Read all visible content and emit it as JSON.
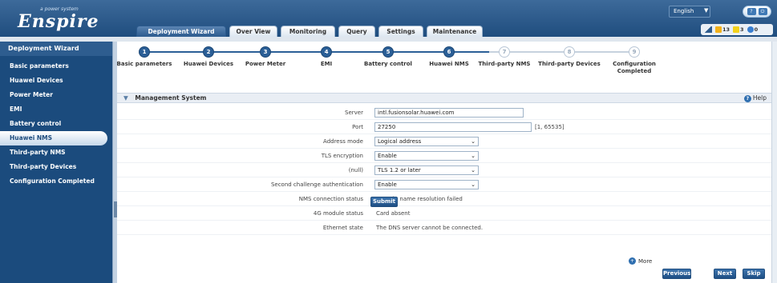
{
  "header": {
    "logo_text": "Enspire",
    "logo_tagline": "a power system",
    "language": "English",
    "alarms": [
      {
        "icon": "major-alarm-icon",
        "count": "13",
        "color": "#f3b21b"
      },
      {
        "icon": "minor-alarm-icon",
        "count": "3",
        "color": "#f3d21b"
      },
      {
        "icon": "info-alarm-icon",
        "count": "0",
        "color": "#3a7fd0"
      }
    ]
  },
  "tabs": [
    {
      "label": "Deployment Wizard",
      "active": true
    },
    {
      "label": "Over View",
      "active": false
    },
    {
      "label": "Monitoring",
      "active": false
    },
    {
      "label": "Query",
      "active": false
    },
    {
      "label": "Settings",
      "active": false
    },
    {
      "label": "Maintenance",
      "active": false
    }
  ],
  "sidebar": {
    "title": "Deployment Wizard",
    "items": [
      {
        "label": "Basic parameters",
        "active": false
      },
      {
        "label": "Huawei Devices",
        "active": false
      },
      {
        "label": "Power Meter",
        "active": false
      },
      {
        "label": "EMI",
        "active": false
      },
      {
        "label": "Battery control",
        "active": false
      },
      {
        "label": "Huawei NMS",
        "active": true
      },
      {
        "label": "Third-party NMS",
        "active": false
      },
      {
        "label": "Third-party Devices",
        "active": false
      },
      {
        "label": "Configuration Completed",
        "active": false
      }
    ]
  },
  "steps": [
    {
      "num": "1",
      "label": "Basic parameters",
      "done": true
    },
    {
      "num": "2",
      "label": "Huawei Devices",
      "done": true
    },
    {
      "num": "3",
      "label": "Power Meter",
      "done": true
    },
    {
      "num": "4",
      "label": "EMI",
      "done": true
    },
    {
      "num": "5",
      "label": "Battery control",
      "done": true
    },
    {
      "num": "6",
      "label": "Huawei NMS",
      "done": true
    },
    {
      "num": "7",
      "label": "Third-party NMS",
      "done": false
    },
    {
      "num": "8",
      "label": "Third-party Devices",
      "done": false
    },
    {
      "num": "9",
      "label": "Configuration Completed",
      "done": false
    }
  ],
  "panel": {
    "title": "Management System",
    "help": "Help"
  },
  "form": {
    "server_label": "Server",
    "server_value": "intl.fusionsolar.huawei.com",
    "port_label": "Port",
    "port_value": "27250",
    "port_range": "[1, 65535]",
    "address_mode_label": "Address mode",
    "address_mode_value": "Logical address",
    "tls_label": "TLS encryption",
    "tls_value": "Enable",
    "null_label": "(null)",
    "null_value": "TLS 1.2 or later",
    "second_auth_label": "Second challenge authentication",
    "second_auth_value": "Enable",
    "nms_status_label": "NMS connection status",
    "nms_status_value": "Domain name resolution failed",
    "module_4g_label": "4G module status",
    "module_4g_value": "Card absent",
    "ethernet_label": "Ethernet state",
    "ethernet_value": "The DNS server cannot be connected.",
    "submit": "Submit"
  },
  "footer": {
    "more": "More",
    "previous": "Previous",
    "next": "Next",
    "skip": "Skip"
  },
  "colors": {
    "header": "#1f4d7e",
    "sidebar": "#1b4b7d",
    "accent": "#2b5f97"
  }
}
